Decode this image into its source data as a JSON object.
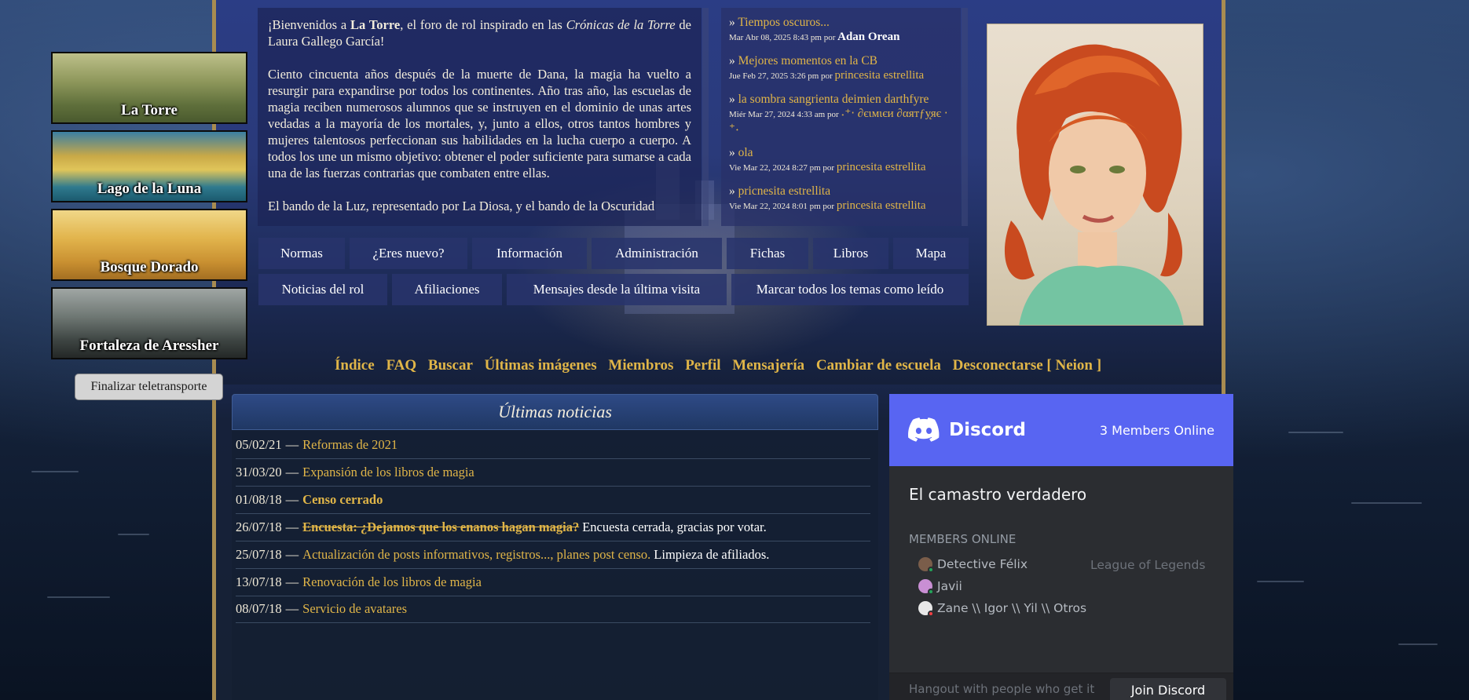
{
  "teleport": {
    "items": [
      {
        "label": "La Torre"
      },
      {
        "label": "Lago de la Luna"
      },
      {
        "label": "Bosque Dorado"
      },
      {
        "label": "Fortaleza de Aressher"
      }
    ],
    "finalize_label": "Finalizar teletransporte"
  },
  "welcome": {
    "p1_a": "¡Bienvenidos a ",
    "p1_bold": "La Torre",
    "p1_b": ", el foro de rol inspirado en las ",
    "p1_italic": "Crónicas de la Torre",
    "p1_c": " de Laura Gallego García!",
    "p2": "Ciento cincuenta años después de la muerte de Dana, la magia ha vuelto a resurgir para expandirse por todos los continentes. Año tras año, las escuelas de magia reciben numerosos alumnos que se instruyen en el dominio de unas artes vedadas a la mayoría de los mortales, y, junto a ellos, otros tantos hombres y mujeres talentosos perfeccionan sus habilidades en la lucha cuerpo a cuerpo. A todos los une un mismo objetivo: obtener el poder suficiente para sumarse a cada una de las fuerzas contrarias que combaten entre ellas.",
    "p3": "El bando de la Luz, representado por La Diosa, y el bando de la Oscuridad"
  },
  "recent_topics": [
    {
      "title": "Tiempos oscuros...",
      "date": "Mar Abr 08, 2025 8:43 pm por",
      "author": "Adan Orean",
      "author_bold": true
    },
    {
      "title": "Mejores momentos en la CB",
      "date": "Jue Feb 27, 2025 3:26 pm por",
      "author": "princesita estrellita",
      "author_bold": false
    },
    {
      "title": "la sombra sangrienta deimien darthfyre",
      "date": "Miér Mar 27, 2024 4:33 am por",
      "author": "˖⁺‧ ∂єιмιєи ∂αятƒу̨яє ‧⁺˖",
      "author_bold": false
    },
    {
      "title": "ola",
      "date": "Vie Mar 22, 2024 8:27 pm por",
      "author": "princesita estrellita",
      "author_bold": false
    },
    {
      "title": "pricnesita estrellita",
      "date": "Vie Mar 22, 2024 8:01 pm por",
      "author": "princesita estrellita",
      "author_bold": false
    }
  ],
  "nav": {
    "row1": [
      "Normas",
      "¿Eres nuevo?",
      "Información",
      "Administración",
      "Fichas",
      "Libros",
      "Mapa"
    ],
    "row2": [
      "Noticias del rol",
      "Afiliaciones",
      "Mensajes desde la última visita",
      "Marcar todos los temas como leído"
    ]
  },
  "gold_links": [
    "Índice",
    "FAQ",
    "Buscar",
    "Últimas imágenes",
    "Miembros",
    "Perfil",
    "Mensajería",
    "Cambiar de escuela",
    "Desconectarse [ Neion ]"
  ],
  "news": {
    "title": "Últimas noticias",
    "items": [
      {
        "date": "05/02/21",
        "link": "Reformas de 2021",
        "style": "normal",
        "extra": ""
      },
      {
        "date": "31/03/20",
        "link": "Expansión de los libros de magia",
        "style": "normal",
        "extra": ""
      },
      {
        "date": "01/08/18",
        "link": "Censo cerrado",
        "style": "bold",
        "extra": ""
      },
      {
        "date": "26/07/18",
        "link": "Encuesta: ¿Dejamos que los enanos hagan magia?",
        "style": "strike",
        "extra": "Encuesta cerrada, gracias por votar."
      },
      {
        "date": "25/07/18",
        "link": "Actualización de posts informativos, registros..., planes post censo.",
        "style": "normal",
        "extra": "Limpieza de afiliados."
      },
      {
        "date": "13/07/18",
        "link": "Renovación de los libros de magia",
        "style": "normal",
        "extra": ""
      },
      {
        "date": "08/07/18",
        "link": "Servicio de avatares",
        "style": "normal",
        "extra": ""
      }
    ]
  },
  "discord": {
    "brand": "Discord",
    "online": "3 Members Online",
    "server": "El camastro verdadero",
    "members_label": "MEMBERS ONLINE",
    "members": [
      {
        "name": "Detective Félix",
        "game": "League of Legends"
      },
      {
        "name": "Javii",
        "game": ""
      },
      {
        "name": "Zane \\\\ Igor \\\\ Yil \\\\ Otros",
        "game": ""
      }
    ],
    "hangout": "Hangout with people who get it",
    "join": "Join Discord",
    "brand_color": "#5865f2"
  },
  "colors": {
    "gold": "#e0b548",
    "frame": "#a88c51"
  }
}
